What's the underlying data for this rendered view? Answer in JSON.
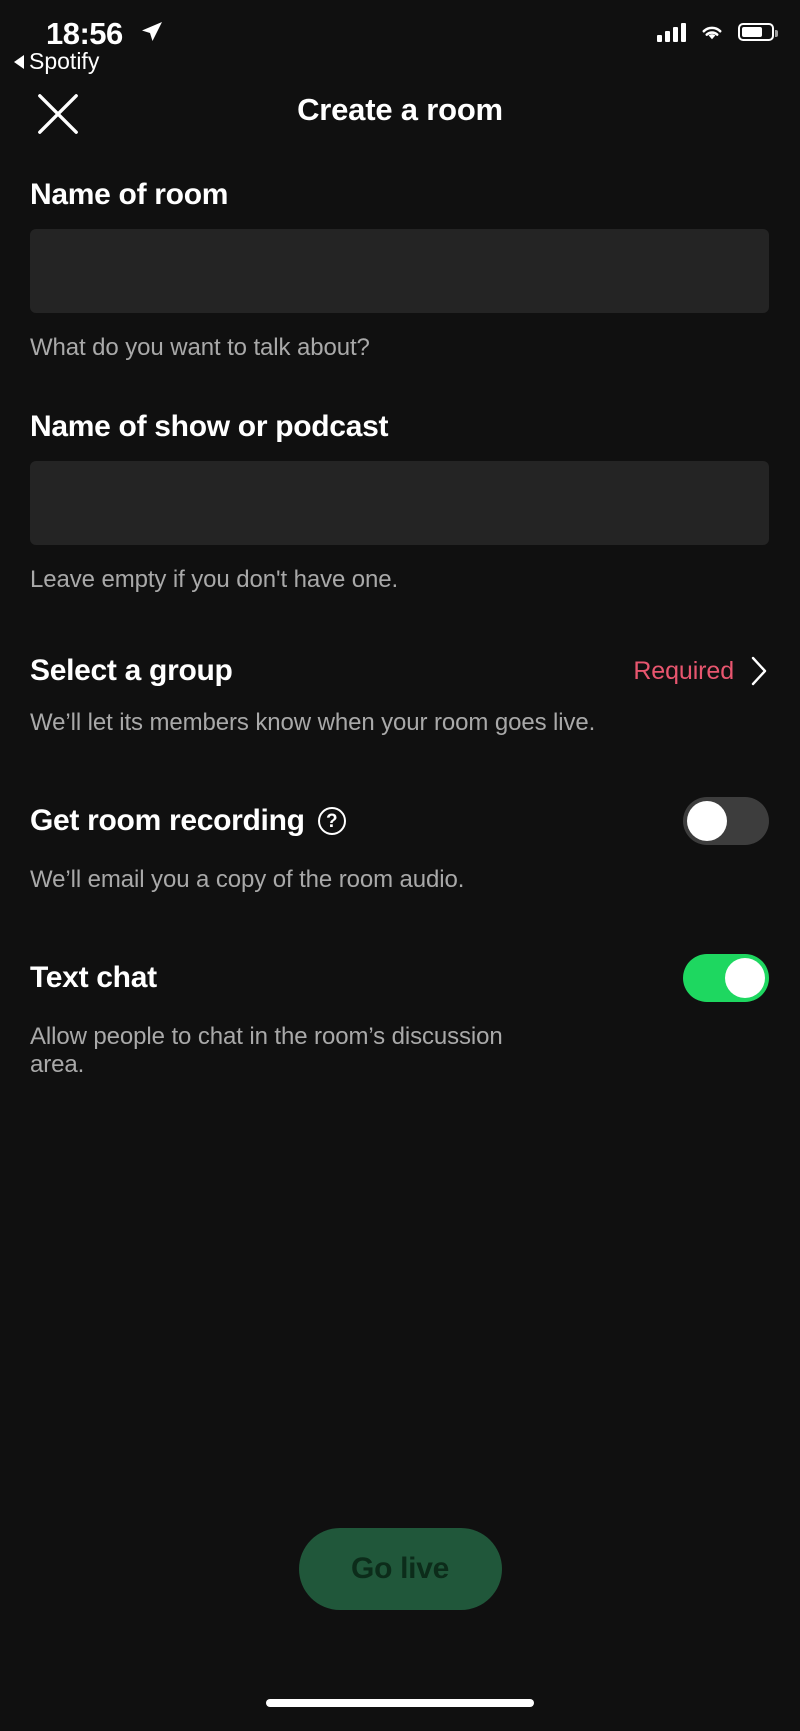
{
  "status_bar": {
    "time": "18:56",
    "back_app": "Spotify",
    "location_icon": "location-arrow-icon",
    "signal_icon": "cellular-signal-icon",
    "wifi_icon": "wifi-icon",
    "battery_icon": "battery-icon"
  },
  "header": {
    "title": "Create a room",
    "close_icon": "close-icon"
  },
  "form": {
    "room_name": {
      "label": "Name of room",
      "value": "",
      "placeholder": "",
      "helper": "What do you want to talk about?"
    },
    "show_name": {
      "label": "Name of show or podcast",
      "value": "",
      "placeholder": "",
      "helper": "Leave empty if you don't have one."
    },
    "select_group": {
      "label": "Select a group",
      "status": "Required",
      "chevron_icon": "chevron-right-icon",
      "helper": "We’ll let its members know when your room goes live."
    },
    "room_recording": {
      "label": "Get room recording",
      "help_icon": "question-mark-icon",
      "helper": "We’ll email you a copy of the room audio.",
      "enabled": false
    },
    "text_chat": {
      "label": "Text chat",
      "helper": "Allow people to chat in the room’s discussion area.",
      "enabled": true
    }
  },
  "footer": {
    "go_live_label": "Go live"
  },
  "colors": {
    "background": "#101010",
    "input_fill": "#242424",
    "accent_green": "#1ed760",
    "required_pink": "#e8566f",
    "disabled_green": "#20573a",
    "helper_text": "#a9a9a9"
  }
}
